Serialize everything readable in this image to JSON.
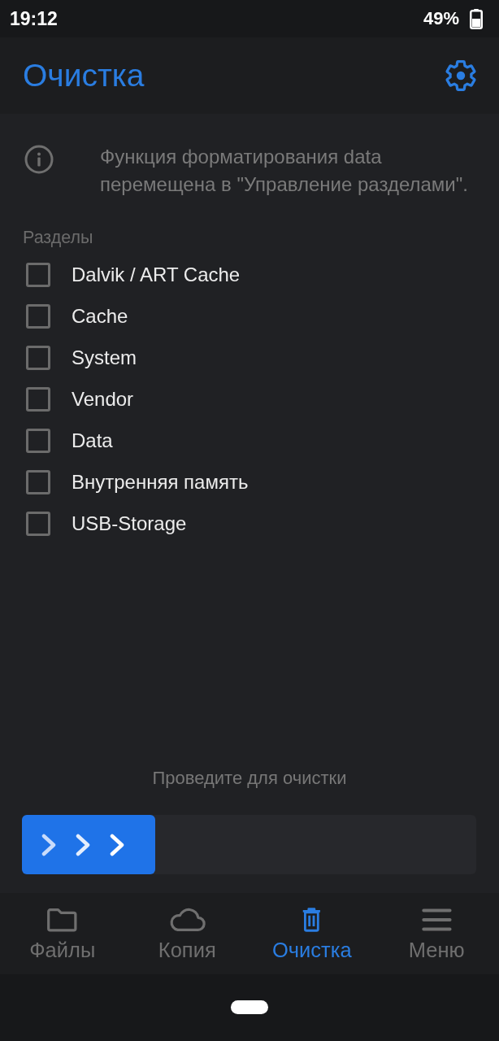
{
  "status_bar": {
    "time": "19:12",
    "battery": "49%"
  },
  "header": {
    "title": "Очистка"
  },
  "info": {
    "text": "Функция форматирования data перемещена в \"Управление разделами\"."
  },
  "partitions": {
    "heading": "Разделы",
    "items": [
      {
        "label": "Dalvik / ART Cache",
        "checked": false
      },
      {
        "label": "Cache",
        "checked": false
      },
      {
        "label": "System",
        "checked": false
      },
      {
        "label": "Vendor",
        "checked": false
      },
      {
        "label": "Data",
        "checked": false
      },
      {
        "label": "Внутренняя память",
        "checked": false
      },
      {
        "label": "USB-Storage",
        "checked": false
      }
    ]
  },
  "swipe": {
    "hint": "Проведите для очистки",
    "level": 0
  },
  "nav": [
    {
      "label": "Файлы",
      "kind": "folder",
      "selected": false
    },
    {
      "label": "Копия",
      "kind": "cloud",
      "selected": false
    },
    {
      "label": "Очистка",
      "kind": "trash",
      "selected": true
    },
    {
      "label": "Меню",
      "kind": "menu",
      "selected": false
    }
  ]
}
